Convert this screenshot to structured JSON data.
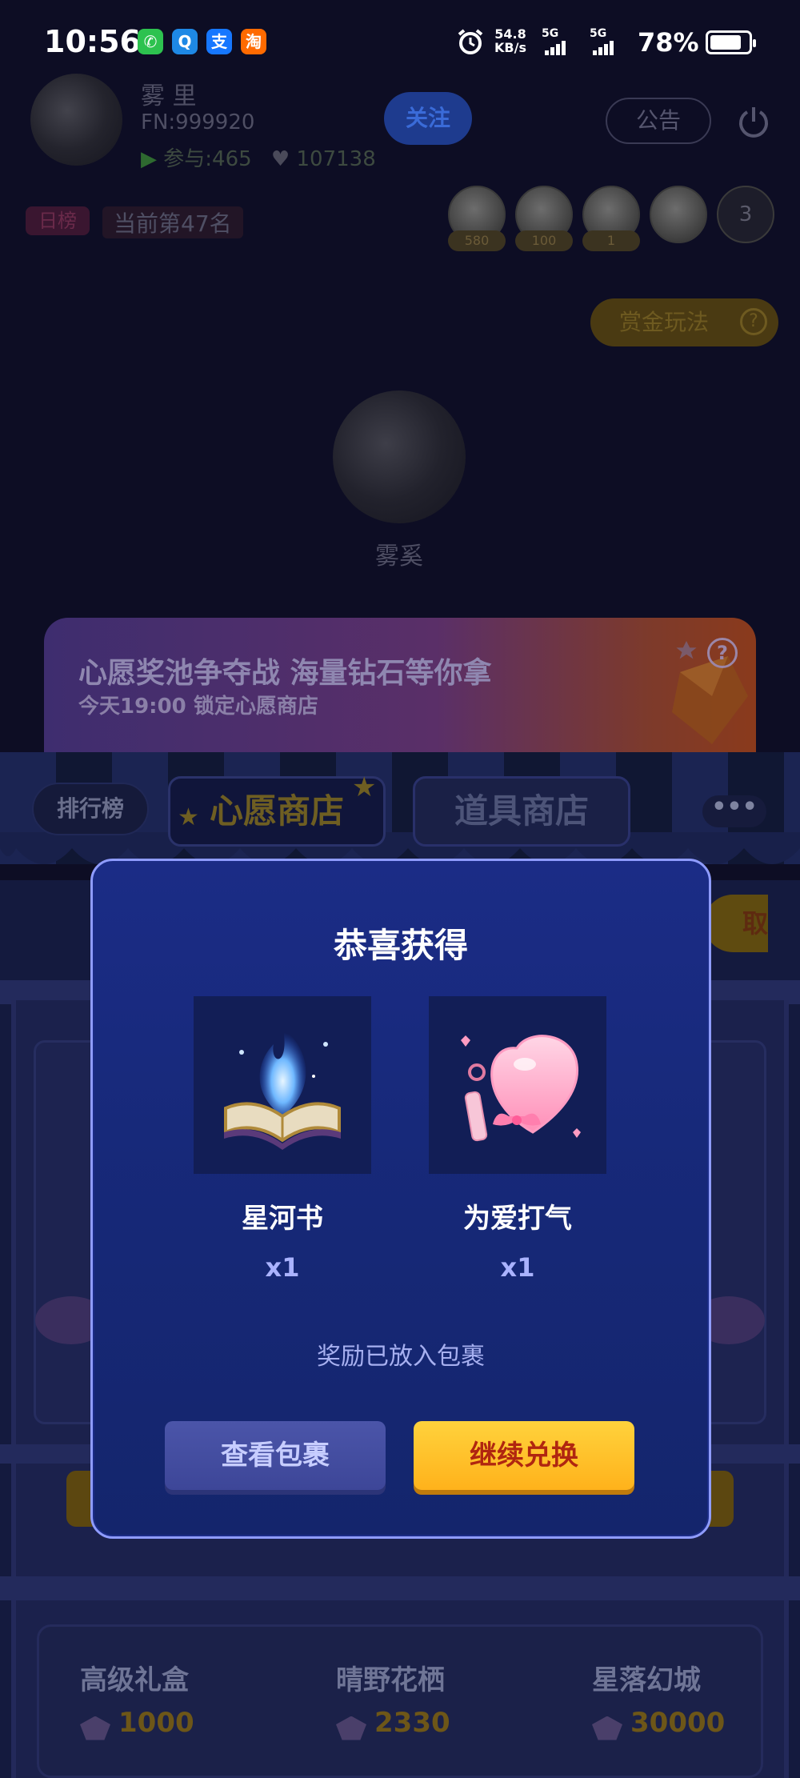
{
  "status_bar": {
    "time": "10:56",
    "apps": [
      {
        "name": "wechat-icon",
        "glyph": "✆",
        "color": "#2dc24f"
      },
      {
        "name": "qq-icon",
        "glyph": "Q",
        "color": "#1e88e5"
      },
      {
        "name": "alipay-icon",
        "glyph": "支",
        "color": "#1677ff"
      },
      {
        "name": "taobao-icon",
        "glyph": "淘",
        "color": "#ff6a00"
      }
    ],
    "net_speed": "54.8",
    "net_unit": "KB/s",
    "sim1": "5G",
    "sim2": "5G",
    "battery": "78%"
  },
  "background": {
    "user_name": "雾 里",
    "user_id": "FN:999920",
    "stats_join": "参与:465",
    "stats_hearts": "107138",
    "follow_label": "关注",
    "notice_label": "公告",
    "rank_badge": "日榜",
    "rank_text": "当前第47名",
    "audience": [
      {
        "tag": "580"
      },
      {
        "tag": "100"
      },
      {
        "tag": "1"
      },
      {
        "tag": ""
      },
      {
        "tag": "3"
      }
    ],
    "gold_pill_label": "赏金玩法",
    "host_name": "雾奚",
    "banner_title": "心愿奖池争夺战 海量钻石等你拿",
    "banner_subtitle": "今天19:00 锁定心愿商店",
    "tabs": {
      "rank": "排行榜",
      "wish_shop": "心愿商店",
      "prop_shop": "道具商店",
      "more": "•••"
    },
    "side_button": "取",
    "bottom_items": [
      {
        "name": "高级礼盒",
        "price": "1000"
      },
      {
        "name": "晴野花栖",
        "price": "2330"
      },
      {
        "name": "星落幻城",
        "price": "30000"
      }
    ]
  },
  "modal": {
    "title": "恭喜获得",
    "rewards": [
      {
        "name": "星河书",
        "count": "x1"
      },
      {
        "name": "为爱打气",
        "count": "x1"
      }
    ],
    "note": "奖励已放入包裹",
    "view_button": "查看包裹",
    "continue_button": "继续兑换"
  }
}
